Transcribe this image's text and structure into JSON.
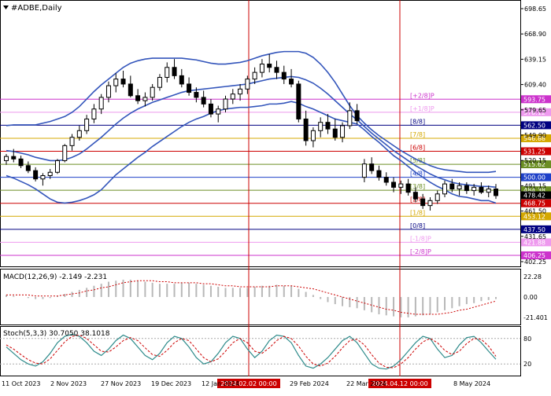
{
  "chart_data": {
    "type": "candlestick",
    "title": "#ADBE,Daily",
    "price_axis": {
      "ylim": [
        393,
        712
      ],
      "tick_labels": [
        "698.65",
        "668.90",
        "639.15",
        "609.40",
        "579.65",
        "549.90",
        "520.15",
        "491.15",
        "461.50",
        "431.65",
        "402.25"
      ]
    },
    "murrey_levels": [
      {
        "label": "[+2/8]P",
        "value": 593.75,
        "value_label": "593.75",
        "color": "#cc33cc"
      },
      {
        "label": "[+1/8]P",
        "value": 578.12,
        "value_label": "578.12",
        "color": "#ee99ee"
      },
      {
        "label": "[8/8]",
        "value": 562.5,
        "value_label": "562.50",
        "color": "#000080"
      },
      {
        "label": "[7/8]",
        "value": 546.88,
        "value_label": "546.88",
        "color": "#d4a800"
      },
      {
        "label": "[6/8]",
        "value": 531.25,
        "value_label": "531.25",
        "color": "#cc0000"
      },
      {
        "label": "[5/8]",
        "value": 515.62,
        "value_label": "515.62",
        "color": "#6b8e23"
      },
      {
        "label": "[4/8]",
        "value": 500.0,
        "value_label": "500.00",
        "color": "#1e40c8"
      },
      {
        "label": "[3/8]",
        "value": 484.38,
        "value_label": "484.38",
        "color": "#6b8e23"
      },
      {
        "label": "[2/8]",
        "value": 468.75,
        "value_label": "468.75",
        "color": "#cc0000"
      },
      {
        "label": "[1/8]",
        "value": 453.12,
        "value_label": "453.12",
        "color": "#d4a800"
      },
      {
        "label": "[0/8]",
        "value": 437.5,
        "value_label": "437.50",
        "color": "#000080"
      },
      {
        "label": "[-1/8]P",
        "value": 421.88,
        "value_label": "421.88",
        "color": "#ee99ee"
      },
      {
        "label": "[-2/8]P",
        "value": 406.25,
        "value_label": "406.25",
        "color": "#cc33cc"
      }
    ],
    "current_price": {
      "value": 478.42,
      "label": "478.42"
    },
    "x_axis": {
      "tick_labels": [
        "11 Oct 2023",
        "2 Nov 2023",
        "27 Nov 2023",
        "19 Dec 2023",
        "12 Jan 2024",
        "29 Feb 2024",
        "22 Mar 2024",
        "8 May 2024"
      ],
      "cursor_labels": [
        "2024.02.02 00:00",
        "2024.04.12 00:00"
      ]
    },
    "candles": [
      [
        520,
        528,
        515,
        525
      ],
      [
        525,
        534,
        518,
        522
      ],
      [
        522,
        526,
        511,
        514
      ],
      [
        514,
        519,
        505,
        508
      ],
      [
        508,
        512,
        495,
        498
      ],
      [
        498,
        505,
        490,
        502
      ],
      [
        502,
        510,
        498,
        506
      ],
      [
        506,
        522,
        504,
        520
      ],
      [
        520,
        540,
        518,
        538
      ],
      [
        538,
        552,
        532,
        548
      ],
      [
        548,
        562,
        544,
        556
      ],
      [
        556,
        575,
        552,
        570
      ],
      [
        570,
        588,
        565,
        582
      ],
      [
        582,
        600,
        576,
        596
      ],
      [
        596,
        615,
        590,
        610
      ],
      [
        610,
        625,
        602,
        618
      ],
      [
        618,
        628,
        608,
        612
      ],
      [
        612,
        622,
        596,
        598
      ],
      [
        598,
        606,
        588,
        592
      ],
      [
        592,
        602,
        585,
        596
      ],
      [
        596,
        612,
        592,
        608
      ],
      [
        608,
        624,
        604,
        620
      ],
      [
        620,
        638,
        614,
        632
      ],
      [
        632,
        642,
        618,
        622
      ],
      [
        622,
        630,
        608,
        612
      ],
      [
        612,
        620,
        598,
        602
      ],
      [
        602,
        608,
        590,
        596
      ],
      [
        596,
        604,
        584,
        588
      ],
      [
        588,
        594,
        572,
        576
      ],
      [
        576,
        586,
        566,
        582
      ],
      [
        582,
        598,
        578,
        594
      ],
      [
        594,
        606,
        588,
        600
      ],
      [
        600,
        612,
        592,
        606
      ],
      [
        606,
        622,
        600,
        618
      ],
      [
        618,
        632,
        612,
        626
      ],
      [
        626,
        642,
        620,
        636
      ],
      [
        636,
        648,
        626,
        632
      ],
      [
        632,
        640,
        618,
        626
      ],
      [
        626,
        634,
        612,
        618
      ],
      [
        618,
        630,
        608,
        612
      ],
      [
        612,
        616,
        566,
        570
      ],
      [
        570,
        580,
        538,
        544
      ],
      [
        544,
        560,
        536,
        556
      ],
      [
        556,
        572,
        548,
        566
      ],
      [
        566,
        576,
        552,
        558
      ],
      [
        558,
        570,
        544,
        548
      ],
      [
        548,
        566,
        542,
        562
      ],
      [
        562,
        590,
        558,
        580
      ],
      [
        580,
        588,
        564,
        568
      ],
      [
        500,
        522,
        494,
        516
      ],
      [
        516,
        524,
        504,
        508
      ],
      [
        508,
        514,
        496,
        500
      ],
      [
        500,
        506,
        490,
        494
      ],
      [
        494,
        500,
        482,
        488
      ],
      [
        488,
        496,
        480,
        492
      ],
      [
        492,
        498,
        478,
        482
      ],
      [
        482,
        488,
        470,
        474
      ],
      [
        474,
        480,
        462,
        466
      ],
      [
        466,
        476,
        460,
        472
      ],
      [
        472,
        484,
        468,
        480
      ],
      [
        480,
        496,
        476,
        492
      ],
      [
        492,
        498,
        482,
        486
      ],
      [
        486,
        494,
        478,
        490
      ],
      [
        490,
        494,
        480,
        484
      ],
      [
        484,
        492,
        478,
        488
      ],
      [
        488,
        494,
        480,
        482
      ],
      [
        482,
        490,
        476,
        486
      ],
      [
        486,
        492,
        474,
        478
      ]
    ],
    "bollinger": {
      "upper": [
        562,
        563,
        563,
        563,
        563,
        565,
        567,
        570,
        573,
        578,
        585,
        594,
        603,
        611,
        618,
        625,
        632,
        637,
        640,
        642,
        643,
        643,
        643,
        643,
        643,
        642,
        641,
        639,
        637,
        636,
        636,
        637,
        638,
        640,
        643,
        646,
        648,
        650,
        651,
        651,
        651,
        649,
        644,
        636,
        626,
        614,
        600,
        586,
        574,
        565,
        557,
        550,
        544,
        538,
        532,
        527,
        522,
        518,
        514,
        511,
        509,
        508,
        507,
        506,
        506,
        506,
        506,
        507
      ],
      "middle": [
        532,
        531,
        529,
        527,
        524,
        522,
        520,
        520,
        521,
        524,
        528,
        534,
        541,
        548,
        556,
        564,
        571,
        577,
        582,
        586,
        590,
        593,
        596,
        599,
        602,
        604,
        605,
        606,
        607,
        608,
        609,
        610,
        611,
        612,
        614,
        616,
        618,
        619,
        620,
        621,
        620,
        617,
        613,
        607,
        600,
        592,
        584,
        576,
        569,
        561,
        553,
        546,
        539,
        532,
        526,
        520,
        514,
        509,
        504,
        500,
        497,
        494,
        492,
        491,
        490,
        489,
        489,
        488
      ],
      "lower": [
        502,
        499,
        495,
        491,
        486,
        480,
        474,
        470,
        469,
        470,
        472,
        475,
        479,
        485,
        494,
        503,
        510,
        517,
        524,
        530,
        537,
        543,
        549,
        555,
        561,
        566,
        570,
        573,
        577,
        580,
        582,
        583,
        584,
        584,
        585,
        586,
        588,
        588,
        589,
        591,
        589,
        585,
        582,
        578,
        574,
        570,
        568,
        566,
        564,
        557,
        549,
        542,
        534,
        526,
        520,
        513,
        506,
        500,
        494,
        489,
        485,
        480,
        477,
        476,
        474,
        472,
        472,
        469
      ]
    },
    "macd": {
      "label": "MACD(12,26,9) -2.149 -2.231",
      "ylim": [
        -27,
        27
      ],
      "tick_labels": [
        "22.28",
        "0.00",
        "-21.401"
      ],
      "histogram": [
        2,
        1,
        0,
        -1,
        -2,
        -2,
        -1,
        1,
        3,
        5,
        7,
        9,
        11,
        13,
        15,
        16,
        17,
        17,
        16,
        15,
        14,
        13,
        13,
        13,
        14,
        14,
        13,
        12,
        11,
        10,
        9,
        9,
        9,
        9,
        10,
        11,
        11,
        12,
        11,
        11,
        8,
        5,
        2,
        -2,
        -5,
        -7,
        -9,
        -10,
        -11,
        -13,
        -15,
        -17,
        -18,
        -19,
        -20,
        -20,
        -19,
        -18,
        -17,
        -15,
        -13,
        -11,
        -9,
        -7,
        -6,
        -4,
        -3,
        -2
      ],
      "signal": [
        2,
        2,
        2,
        2,
        1,
        1,
        1,
        1,
        2,
        3,
        4,
        6,
        7,
        9,
        10,
        12,
        14,
        15,
        16,
        16,
        16,
        15,
        15,
        14,
        14,
        14,
        14,
        13,
        13,
        12,
        11,
        11,
        10,
        10,
        10,
        10,
        10,
        11,
        11,
        11,
        10,
        9,
        8,
        6,
        4,
        2,
        0,
        -2,
        -4,
        -6,
        -8,
        -10,
        -12,
        -13,
        -15,
        -16,
        -17,
        -17,
        -17,
        -17,
        -16,
        -15,
        -13,
        -12,
        -10,
        -8,
        -6,
        -4
      ]
    },
    "stochastic": {
      "label": "Stoch(5,3,3) 30.7050 38.1018",
      "ylim": [
        0,
        100
      ],
      "tick_labels": [
        "80",
        "20"
      ],
      "levels": [
        80,
        20
      ],
      "k": [
        60,
        45,
        30,
        20,
        15,
        25,
        45,
        70,
        85,
        90,
        85,
        70,
        50,
        40,
        55,
        75,
        88,
        80,
        60,
        40,
        30,
        45,
        70,
        85,
        80,
        60,
        35,
        20,
        25,
        45,
        70,
        85,
        80,
        55,
        35,
        50,
        75,
        88,
        85,
        70,
        40,
        15,
        10,
        20,
        35,
        55,
        75,
        85,
        70,
        45,
        20,
        10,
        8,
        15,
        30,
        50,
        70,
        85,
        80,
        55,
        35,
        40,
        65,
        82,
        85,
        70,
        50,
        31
      ],
      "d": [
        65,
        55,
        42,
        30,
        22,
        20,
        32,
        52,
        72,
        85,
        88,
        80,
        65,
        50,
        48,
        60,
        75,
        82,
        75,
        58,
        42,
        38,
        52,
        70,
        80,
        75,
        55,
        35,
        25,
        32,
        50,
        70,
        80,
        70,
        50,
        45,
        58,
        75,
        85,
        80,
        62,
        38,
        20,
        15,
        22,
        38,
        58,
        75,
        78,
        65,
        42,
        22,
        12,
        11,
        20,
        35,
        55,
        72,
        80,
        70,
        52,
        42,
        50,
        68,
        80,
        78,
        62,
        38
      ]
    }
  }
}
